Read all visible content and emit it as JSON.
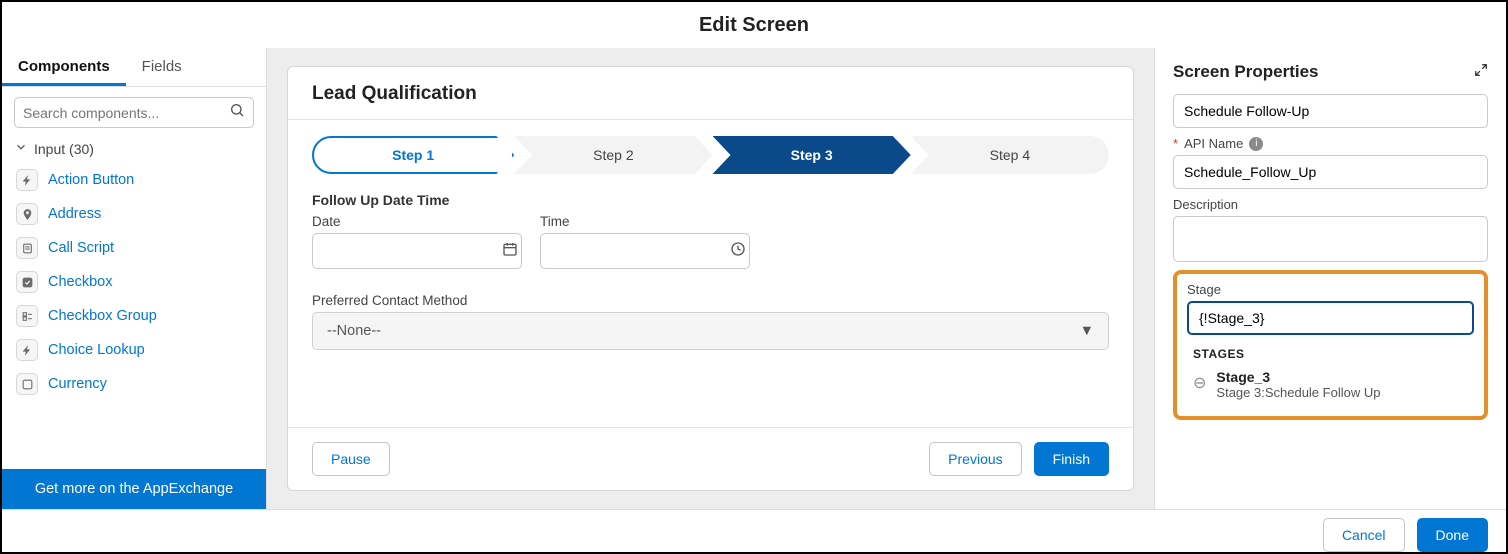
{
  "modal": {
    "title": "Edit Screen"
  },
  "left": {
    "tabs": {
      "components": "Components",
      "fields": "Fields"
    },
    "search_placeholder": "Search components...",
    "group_label": "Input (30)",
    "items": [
      {
        "label": "Action Button"
      },
      {
        "label": "Address"
      },
      {
        "label": "Call Script"
      },
      {
        "label": "Checkbox"
      },
      {
        "label": "Checkbox Group"
      },
      {
        "label": "Choice Lookup"
      },
      {
        "label": "Currency"
      }
    ],
    "appexchange": "Get more on the AppExchange"
  },
  "canvas": {
    "title": "Lead Qualification",
    "steps": [
      "Step 1",
      "Step 2",
      "Step 3",
      "Step 4"
    ],
    "section1_label": "Follow Up Date Time",
    "date_label": "Date",
    "time_label": "Time",
    "date_value": "",
    "time_value": "",
    "section2_label": "Preferred Contact Method",
    "contact_value": "--None--",
    "buttons": {
      "pause": "Pause",
      "previous": "Previous",
      "finish": "Finish"
    }
  },
  "right": {
    "header": "Screen Properties",
    "label_value": "Schedule Follow-Up",
    "api_label": "API Name",
    "api_value": "Schedule_Follow_Up",
    "desc_label": "Description",
    "desc_value": "",
    "stage_label": "Stage",
    "stage_value": "{!Stage_3}",
    "dropdown": {
      "header": "STAGES",
      "item_title": "Stage_3",
      "item_sub": "Stage 3:Schedule Follow Up"
    }
  },
  "footer": {
    "cancel": "Cancel",
    "done": "Done"
  }
}
